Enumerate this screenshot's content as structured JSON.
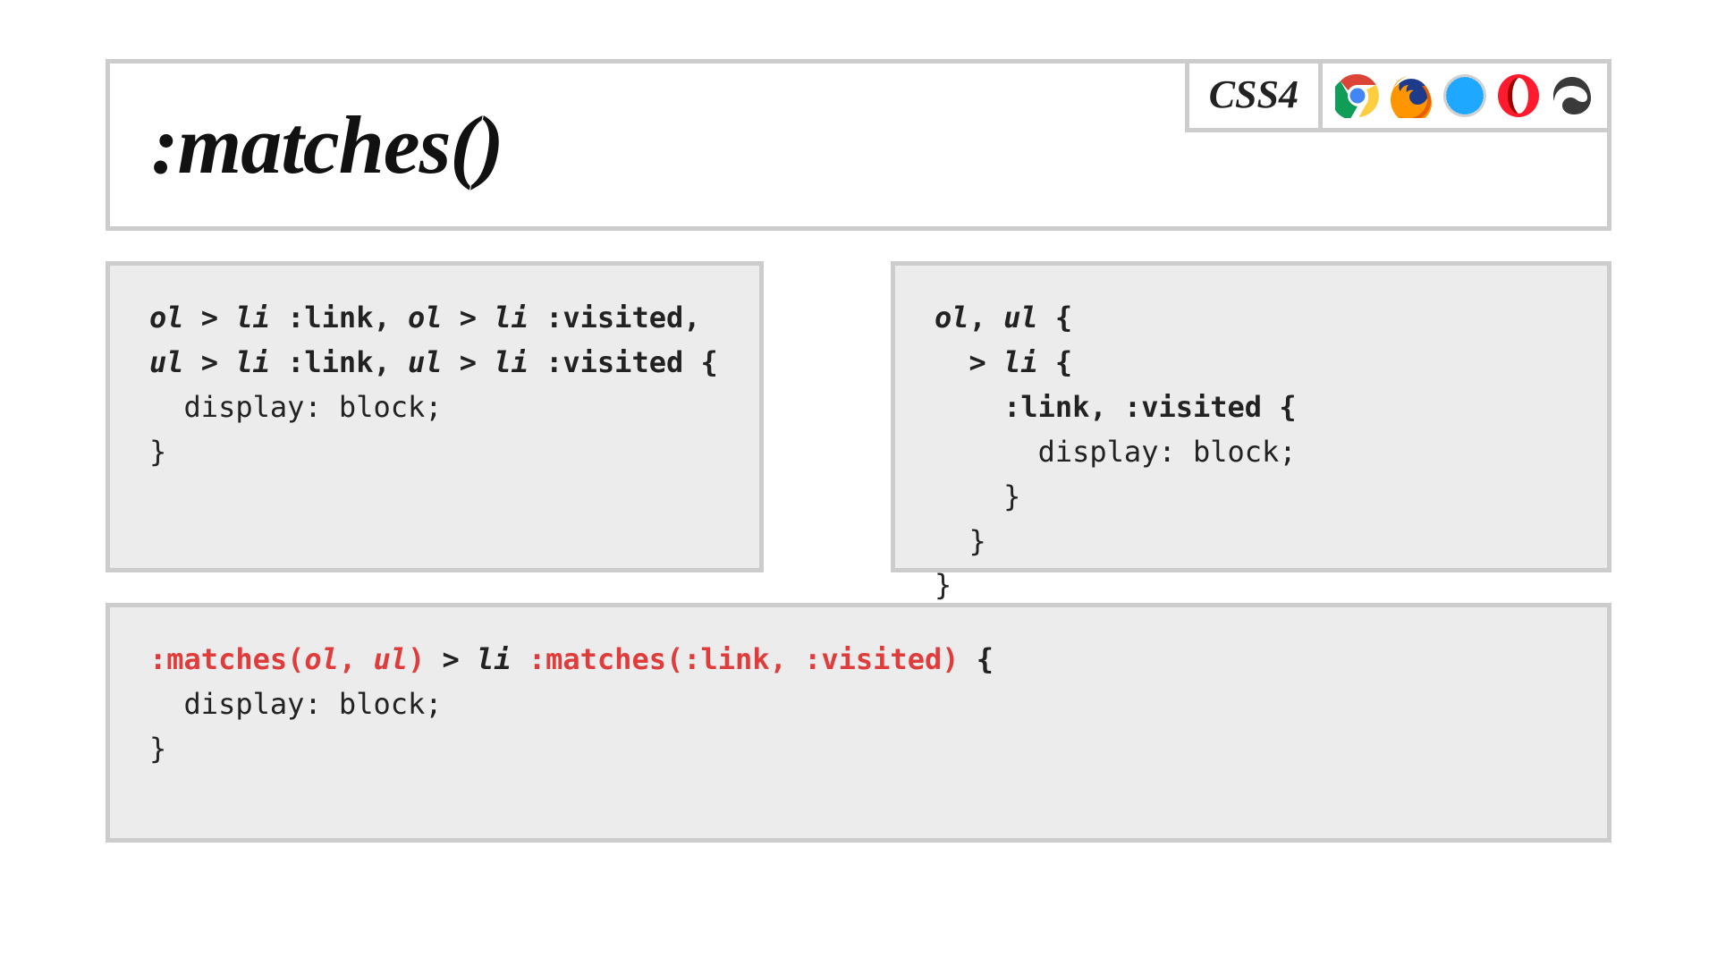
{
  "header": {
    "title": ":matches()",
    "badge": "CSS4",
    "browsers": [
      "chrome",
      "firefox",
      "safari",
      "opera",
      "edge"
    ]
  },
  "code_left": {
    "l1a": "ol",
    "l1b": " > ",
    "l1c": "li",
    "l1d": " :link,",
    "l1e": " ol",
    "l1f": " > ",
    "l1g": "li",
    "l1h": " :visited,",
    "l2a": "ul",
    "l2b": " > ",
    "l2c": "li",
    "l2d": " :link,",
    "l2e": " ul",
    "l2f": " > ",
    "l2g": "li",
    "l2h": " :visited {",
    "l3": "  display: block;",
    "l4": "}"
  },
  "code_right": {
    "l1a": "ol",
    "l1b": ", ",
    "l1c": "ul",
    "l1d": " {",
    "l2a": "  > ",
    "l2b": "li",
    "l2c": " {",
    "l3": "    :link, :visited {",
    "l4": "      display: block;",
    "l5": "    }",
    "l6": "  }",
    "l7": "}"
  },
  "code_bottom": {
    "l1a": ":matches(",
    "l1b": "ol",
    "l1c": ", ",
    "l1d": "ul",
    "l1e": ")",
    "l1f": " > ",
    "l1g": "li",
    "l1h": " ",
    "l1i": ":matches(:link, :visited)",
    "l1j": " {",
    "l2": "  display: block;",
    "l3": "}"
  }
}
